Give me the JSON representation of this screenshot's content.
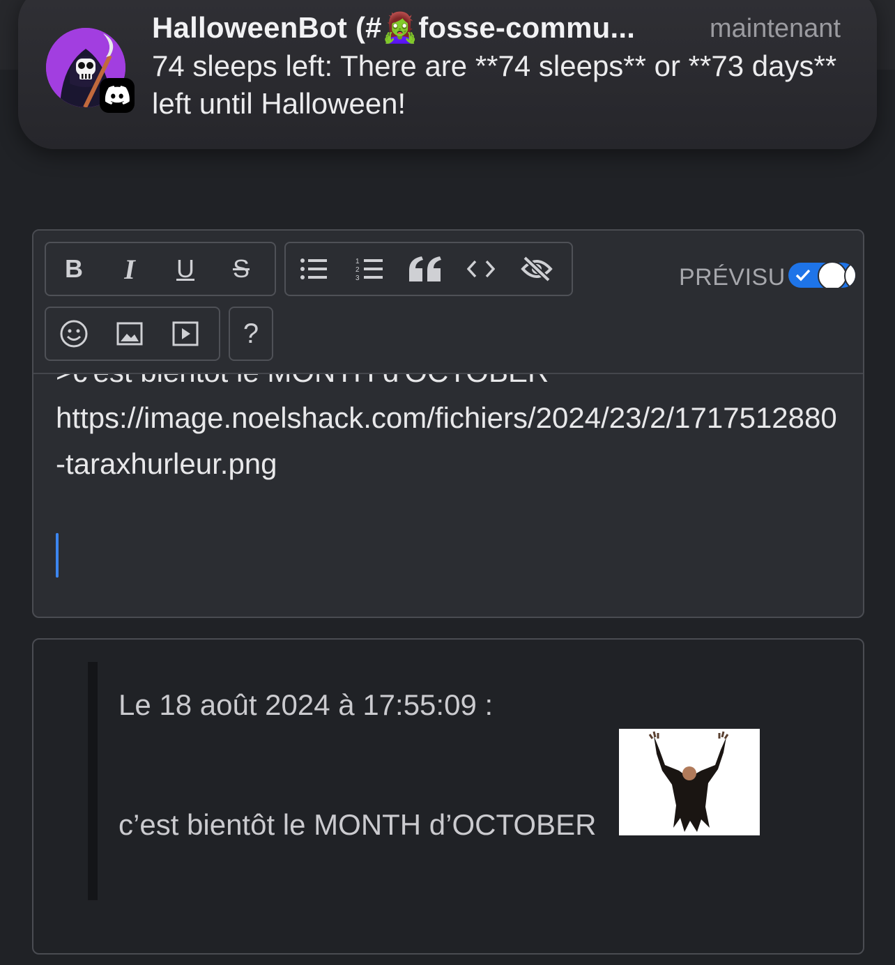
{
  "notification": {
    "title": "HalloweenBot (#🧟‍♀️fosse-commu...",
    "time": "maintenant",
    "body": "74 sleeps left: There are **74 sleeps** or **73 days** left until Halloween!",
    "app_icon": "discord-icon",
    "avatar_icon": "grim-reaper-icon"
  },
  "editor": {
    "toolbar": {
      "format_buttons": [
        "bold",
        "italic",
        "underline",
        "strikethrough"
      ],
      "format_labels": {
        "bold": "B",
        "italic": "I",
        "underline": "U",
        "strikethrough": "S"
      },
      "block_buttons": [
        "bulleted-list",
        "numbered-list",
        "quote",
        "code",
        "spoiler"
      ],
      "media_buttons": [
        "emoji",
        "image",
        "video"
      ],
      "help_label": "?",
      "preview_label": "PRÉVISU",
      "preview_enabled": true
    },
    "text_cut_line": ">c'est bientot le MONTH d'OCTOBER",
    "text_url": "https://image.noelshack.com/fichiers/2024/23/2/1717512880-taraxhurleur.png"
  },
  "preview": {
    "quote_header": "Le 18 août 2024 à 17:55:09 :",
    "quote_text": "c’est bientôt le MONTH d’OCTOBER",
    "quote_image": "reaper-sticker-image"
  },
  "colors": {
    "background": "#202226",
    "accent": "#1e74e8",
    "avatar_bg": "#a23ee0"
  }
}
